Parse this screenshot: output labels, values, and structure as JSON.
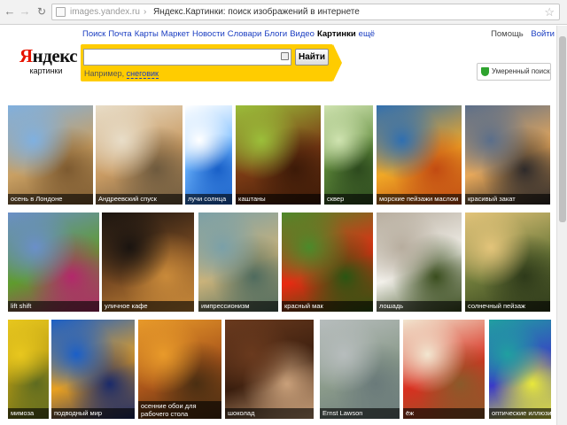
{
  "browser": {
    "url_host": "images.yandex.ru",
    "url_separator": "›",
    "page_title": "Яндекс.Картинки: поиск изображений в интернете"
  },
  "logo": {
    "first_letter": "Я",
    "rest": "ндекс",
    "subtitle": "картинки"
  },
  "services": [
    {
      "label": "Поиск",
      "current": false
    },
    {
      "label": "Почта",
      "current": false
    },
    {
      "label": "Карты",
      "current": false
    },
    {
      "label": "Маркет",
      "current": false
    },
    {
      "label": "Новости",
      "current": false
    },
    {
      "label": "Словари",
      "current": false
    },
    {
      "label": "Блоги",
      "current": false
    },
    {
      "label": "Видео",
      "current": false
    },
    {
      "label": "Картинки",
      "current": true
    },
    {
      "label": "ещё",
      "current": false
    }
  ],
  "search": {
    "value": "",
    "button_label": "Найти",
    "example_prefix": "Например, ",
    "example_query": "снеговик"
  },
  "user": {
    "help": "Помощь",
    "login": "Войти"
  },
  "filter": {
    "label": "Умеренный поиск",
    "accent": "#2ea32e"
  },
  "accent_color": "#ffcc00",
  "tiles": [
    {
      "caption": "осень в Лондоне",
      "colors": [
        "#7fb0e0",
        "#c9a063",
        "#7d5a30"
      ]
    },
    {
      "caption": "Андреевский спуск",
      "colors": [
        "#e8ddc8",
        "#c99b63",
        "#6e5a3e"
      ]
    },
    {
      "caption": "лучи солнца",
      "colors": [
        "#ffffff",
        "#6fb7ff",
        "#1960c8"
      ]
    },
    {
      "caption": "каштаны",
      "colors": [
        "#9bbf3a",
        "#7a3a14",
        "#3c1a08"
      ]
    },
    {
      "caption": "сквер",
      "colors": [
        "#cfe3b0",
        "#5f8a3a",
        "#2d4a1e"
      ]
    },
    {
      "caption": "морские пейзажи маслом",
      "colors": [
        "#2f6fb1",
        "#f0a826",
        "#c24b12"
      ]
    },
    {
      "caption": "красивый закат",
      "colors": [
        "#5a6e8a",
        "#e7a85a",
        "#2e2a2a"
      ]
    },
    {
      "caption": "lift shift",
      "colors": [
        "#6a8fc9",
        "#5f9b2d",
        "#b3286b"
      ]
    },
    {
      "caption": "уличное кафе",
      "colors": [
        "#1a1410",
        "#7a4b22",
        "#c98a3a"
      ]
    },
    {
      "caption": "импрессионизм",
      "colors": [
        "#7aa0a8",
        "#c9b27a",
        "#4f6b5e"
      ]
    },
    {
      "caption": "красный мак",
      "colors": [
        "#4b8a2a",
        "#e82a12",
        "#2a5512"
      ]
    },
    {
      "caption": "лошадь",
      "colors": [
        "#b7ad9e",
        "#f2f0ea",
        "#3a4d1e"
      ]
    },
    {
      "caption": "солнечный пейзаж",
      "colors": [
        "#e3c47a",
        "#6e7a3a",
        "#2e3a1a"
      ]
    },
    {
      "caption": "мимоза",
      "colors": [
        "#e8c71e",
        "#b79a12",
        "#5e6b20"
      ]
    },
    {
      "caption": "подводный мир",
      "colors": [
        "#1a5fc8",
        "#e8a020",
        "#1a2a6a"
      ]
    },
    {
      "caption": "осенние обои для рабочего стола",
      "colors": [
        "#e89a2a",
        "#a8541a",
        "#4a2e12"
      ]
    },
    {
      "caption": "шоколад",
      "colors": [
        "#6a3a1e",
        "#3a1e0e",
        "#c9a07a"
      ]
    },
    {
      "caption": "Ernst Lawson",
      "colors": [
        "#b7bdbd",
        "#8a9a8a",
        "#6a7a7a"
      ]
    },
    {
      "caption": "ёж",
      "colors": [
        "#f2e6d0",
        "#d83020",
        "#8a5a2a"
      ]
    },
    {
      "caption": "оптические иллюзии",
      "colors": [
        "#20a0a0",
        "#3a3ac8",
        "#e8e83a"
      ]
    }
  ]
}
